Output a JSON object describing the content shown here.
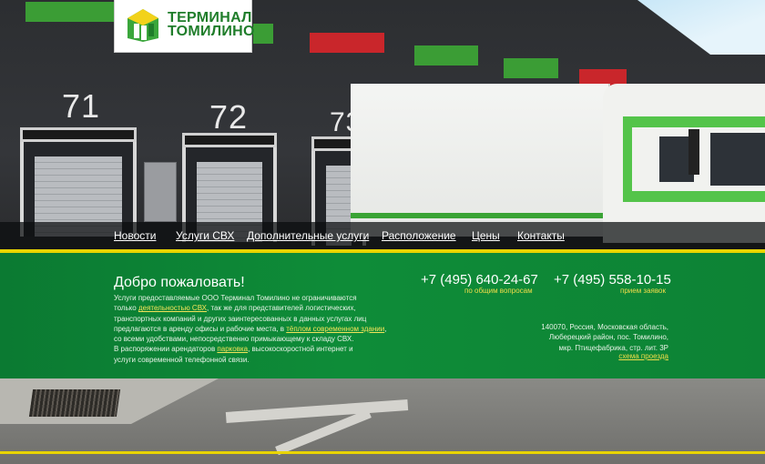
{
  "brand": {
    "name_line1": "ТЕРМИНАЛ",
    "name_line2": "ТОМИЛИНО"
  },
  "doors": {
    "d71": "71",
    "d72": "72",
    "d73": "73"
  },
  "nav": {
    "items": [
      {
        "label": "Новости"
      },
      {
        "label": "Услуги СВХ"
      },
      {
        "label": "Дополнительные услуги"
      },
      {
        "label": "Расположение"
      },
      {
        "label": "Цены"
      },
      {
        "label": "Контакты"
      }
    ]
  },
  "welcome": {
    "title": "Добро пожаловать!",
    "t1": "Услуги предоставляемые ООО Терминал Томилино не ограничиваются",
    "t2": "только ",
    "link_svh": "деятельностью СВХ",
    "t3": ", так же для представителей логистических,",
    "t4": "транспортных компаний и других заинтересованных в данных услугах лиц",
    "t5": "предлагаются в аренду офисы и рабочие места, в ",
    "link_building": "тёплом современном здании",
    "t6": ",",
    "t7": "со всеми удобствами, непосредственно примыкающему к складу СВХ.",
    "t8": "В распоряжении арендаторов ",
    "link_parking": "парковка",
    "t9": ", высокоскоростной интернет и",
    "t10": "услуги современной телефонной связи."
  },
  "contacts": {
    "phone1": "+7 (495) 640-24-67",
    "phone1_note": "по общим вопросам",
    "phone2": "+7 (495) 558-10-15",
    "phone2_note": "прием заявок",
    "address_l1": "140070, Россия, Московская область,",
    "address_l2": "Люберецкий район, пос. Томилино,",
    "address_l3": "мкр. Птицефабрика, стр. лит. 3Р",
    "map_link": "схема проезда"
  },
  "colors": {
    "accent_green": "#0e8c38",
    "accent_yellow": "#e9d400",
    "link_yellow": "#f0dd4a"
  }
}
